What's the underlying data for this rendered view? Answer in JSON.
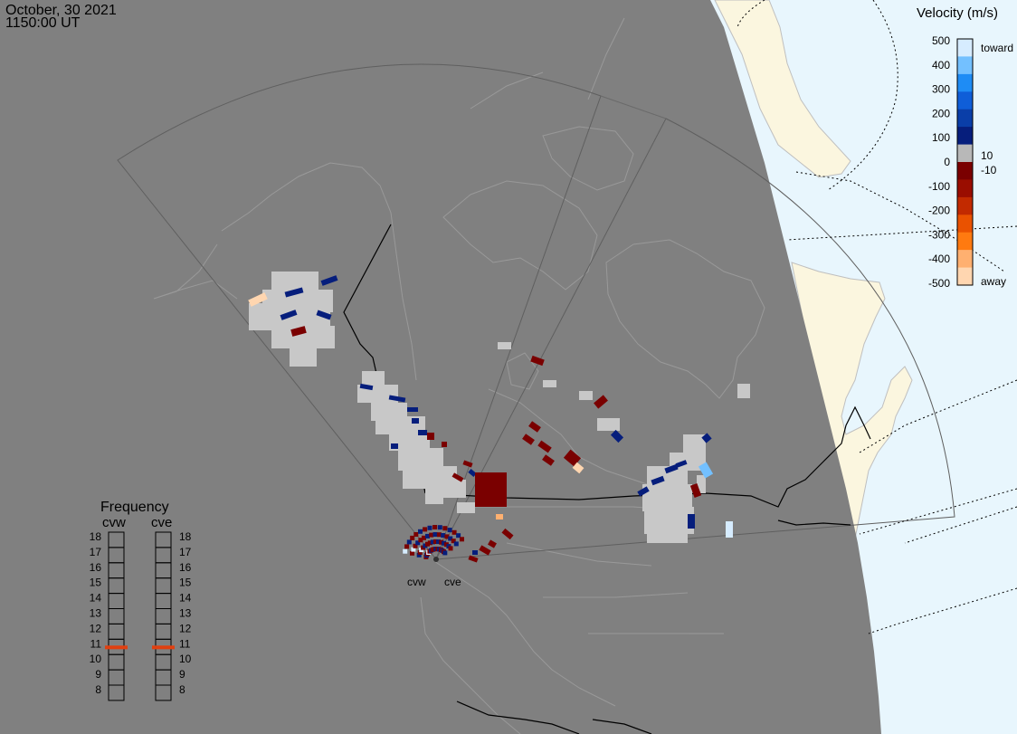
{
  "header": {
    "date": "October, 30 2021",
    "time": "1150:00 UT"
  },
  "legend": {
    "title": "Velocity (m/s)",
    "toward_label": "toward",
    "away_label": "away",
    "ticks": [
      "500",
      "400",
      "300",
      "200",
      "100",
      "0",
      "-100",
      "-200",
      "-300",
      "-400",
      "-500"
    ],
    "threshold_positive": "10",
    "threshold_negative": "-10",
    "colors": [
      "#d6ecff",
      "#73c0ff",
      "#1e8cf5",
      "#0f5ed8",
      "#0a3ea8",
      "#061e7c",
      "#b8b8b8",
      "#7a0000",
      "#9a0d00",
      "#c22a00",
      "#ea5200",
      "#ff7a10",
      "#ffb070",
      "#ffd6b0"
    ]
  },
  "frequency": {
    "title": "Frequency",
    "radars": [
      "cvw",
      "cve"
    ],
    "levels": [
      "18",
      "17",
      "16",
      "15",
      "14",
      "13",
      "12",
      "11",
      "10",
      "9",
      "8"
    ],
    "current": [
      11,
      11
    ],
    "marker_color": "#e04010"
  },
  "radars": {
    "site_labels": [
      "cvw",
      "cve"
    ]
  },
  "colors": {
    "night": "#808080",
    "day_land": "#fbf6df",
    "day_ocean": "#e8f6fd",
    "gridline": "#9a9a9a",
    "ground_scatter": "#c8c8c8"
  }
}
